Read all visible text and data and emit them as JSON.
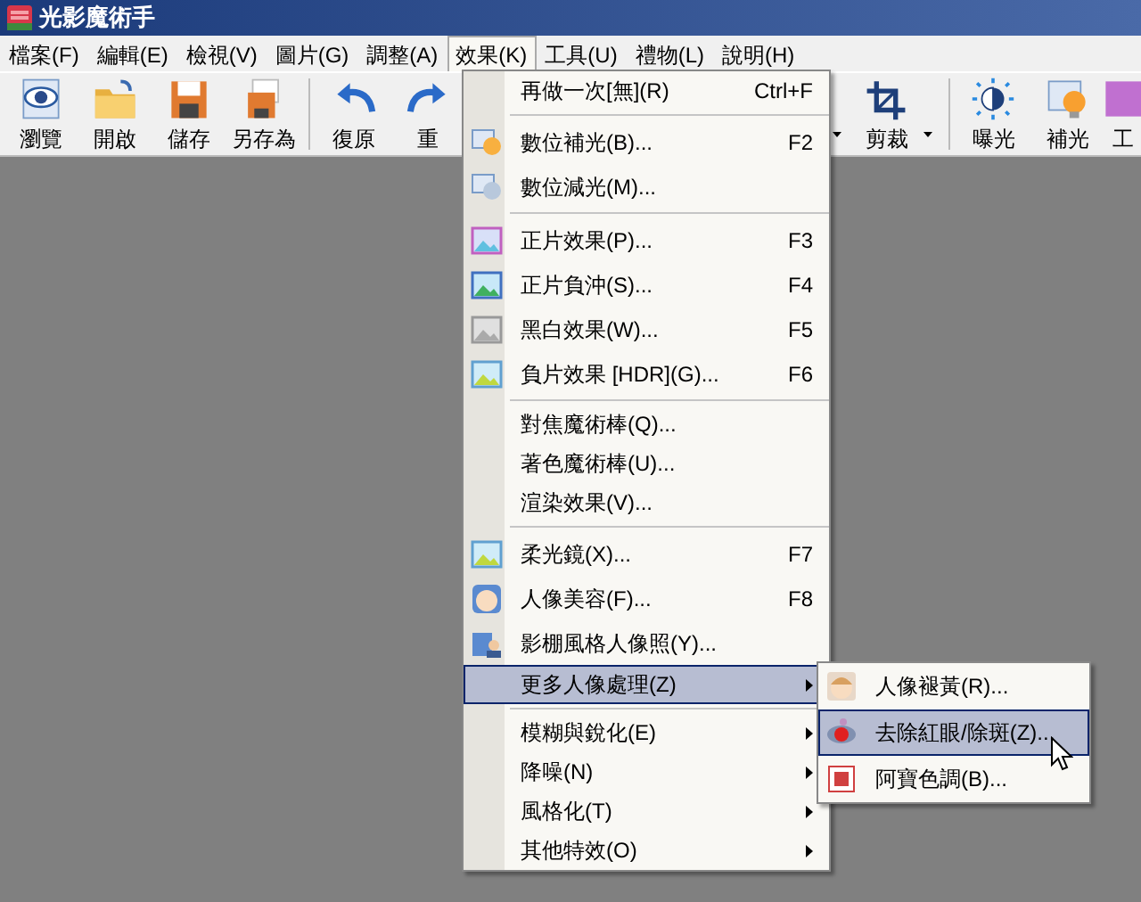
{
  "window": {
    "title": "光影魔術手"
  },
  "menu_bar": [
    {
      "label": "檔案(F)",
      "selected": false
    },
    {
      "label": "編輯(E)",
      "selected": false
    },
    {
      "label": "檢視(V)",
      "selected": false
    },
    {
      "label": "圖片(G)",
      "selected": false
    },
    {
      "label": "調整(A)",
      "selected": false
    },
    {
      "label": "效果(K)",
      "selected": true
    },
    {
      "label": "工具(U)",
      "selected": false
    },
    {
      "label": "禮物(L)",
      "selected": false
    },
    {
      "label": "說明(H)",
      "selected": false
    }
  ],
  "toolbar_left": [
    {
      "label": "瀏覽"
    },
    {
      "label": "開啟"
    },
    {
      "label": "儲存"
    },
    {
      "label": "另存為"
    },
    {
      "kind": "separator"
    },
    {
      "label": "復原"
    },
    {
      "label": "重"
    }
  ],
  "toolbar_right": [
    {
      "kind": "caret"
    },
    {
      "label": "剪裁"
    },
    {
      "kind": "caret"
    },
    {
      "kind": "separator"
    },
    {
      "label": "曝光"
    },
    {
      "label": "補光"
    },
    {
      "label": "工"
    }
  ],
  "effects_menu": [
    {
      "kind": "item",
      "label": "再做一次[無](R)",
      "shortcut": "Ctrl+F",
      "submenu": false,
      "selected": false
    },
    {
      "kind": "separator"
    },
    {
      "kind": "item",
      "label": "數位補光(B)...",
      "shortcut": "F2",
      "submenu": false,
      "selected": false
    },
    {
      "kind": "item",
      "label": "數位減光(M)...",
      "submenu": false,
      "selected": false
    },
    {
      "kind": "separator"
    },
    {
      "kind": "item",
      "label": "正片效果(P)...",
      "shortcut": "F3",
      "submenu": false,
      "selected": false
    },
    {
      "kind": "item",
      "label": "正片負沖(S)...",
      "shortcut": "F4",
      "submenu": false,
      "selected": false
    },
    {
      "kind": "item",
      "label": "黑白效果(W)...",
      "shortcut": "F5",
      "submenu": false,
      "selected": false
    },
    {
      "kind": "item",
      "label": "負片效果 [HDR](G)...",
      "shortcut": "F6",
      "submenu": false,
      "selected": false
    },
    {
      "kind": "separator"
    },
    {
      "kind": "item",
      "label": "對焦魔術棒(Q)...",
      "submenu": false,
      "selected": false
    },
    {
      "kind": "item",
      "label": "著色魔術棒(U)...",
      "submenu": false,
      "selected": false
    },
    {
      "kind": "item",
      "label": "渲染效果(V)...",
      "submenu": false,
      "selected": false
    },
    {
      "kind": "separator"
    },
    {
      "kind": "item",
      "label": "柔光鏡(X)...",
      "shortcut": "F7",
      "submenu": false,
      "selected": false
    },
    {
      "kind": "item",
      "label": "人像美容(F)...",
      "shortcut": "F8",
      "submenu": false,
      "selected": false
    },
    {
      "kind": "item",
      "label": "影棚風格人像照(Y)...",
      "submenu": false,
      "selected": false
    },
    {
      "kind": "item",
      "label": "更多人像處理(Z)",
      "submenu": true,
      "selected": true
    },
    {
      "kind": "separator"
    },
    {
      "kind": "item",
      "label": "模糊與銳化(E)",
      "submenu": true,
      "selected": false
    },
    {
      "kind": "item",
      "label": "降噪(N)",
      "submenu": true,
      "selected": false
    },
    {
      "kind": "item",
      "label": "風格化(T)",
      "submenu": true,
      "selected": false
    },
    {
      "kind": "item",
      "label": "其他特效(O)",
      "submenu": true,
      "selected": false
    }
  ],
  "portrait_submenu": [
    {
      "label": "人像褪黃(R)...",
      "selected": false
    },
    {
      "label": "去除紅眼/除斑(Z)...",
      "selected": true
    },
    {
      "label": "阿寶色調(B)...",
      "selected": false
    }
  ]
}
